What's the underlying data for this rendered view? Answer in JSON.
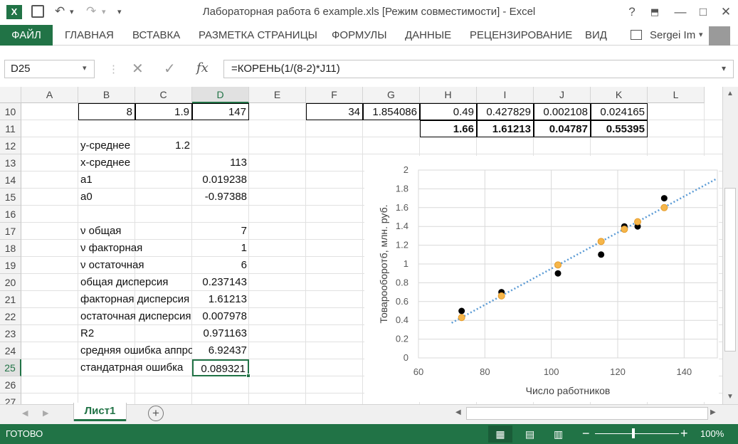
{
  "window": {
    "title": "Лабораторная работа 6 example.xls  [Режим совместимости] - Excel",
    "help": "?",
    "minimize": "—",
    "restore": "□",
    "close": "✕"
  },
  "ribbon": {
    "tabs": [
      "ФАЙЛ",
      "ГЛАВНАЯ",
      "ВСТАВКА",
      "РАЗМЕТКА СТРАНИЦЫ",
      "ФОРМУЛЫ",
      "ДАННЫЕ",
      "РЕЦЕНЗИРОВАНИЕ",
      "ВИД"
    ],
    "user": "Sergei Im"
  },
  "formula_bar": {
    "name_box": "D25",
    "formula": "=КОРЕНЬ(1/(8-2)*J11)",
    "fx": "fx"
  },
  "grid": {
    "columns": [
      "A",
      "B",
      "C",
      "D",
      "E",
      "F",
      "G",
      "H",
      "I",
      "J",
      "K",
      "L"
    ],
    "rows": [
      "10",
      "11",
      "12",
      "13",
      "14",
      "15",
      "16",
      "17",
      "18",
      "19",
      "20",
      "21",
      "22",
      "23",
      "24",
      "25",
      "26",
      "27"
    ],
    "selected_col": "D",
    "selected_row": "25",
    "cells": {
      "B10": "8",
      "C10": "1.9",
      "D10": "147",
      "F10": "34",
      "G10": "1.854086",
      "H10": "0.49",
      "I10": "0.427829",
      "J10": "0.002108",
      "K10": "0.024165",
      "H11": "1.66",
      "I11": "1.61213",
      "J11": "0.04787",
      "K11": "0.55395",
      "B12": "y-среднее",
      "C12": "1.2",
      "B13": "x-среднее",
      "D13": "113",
      "B14": "a1",
      "D14": "0.019238",
      "B15": "a0",
      "D15": "-0.97388",
      "B17": "ν общая",
      "D17": "7",
      "B18": "ν факторная",
      "D18": "1",
      "B19": "ν остаточная",
      "D19": "6",
      "B20": "общая дисперсия",
      "D20": "0.237143",
      "B21": "факторная дисперсия",
      "D21": "1.61213",
      "B22": "остаточная дисперсия",
      "D22": "0.007978",
      "B23": "R2",
      "D23": "0.971163",
      "B24": "средняя ошибка аппроксимации",
      "D24": "6.92437",
      "B25": "стандатрная ошибка",
      "D25": "0.089321"
    }
  },
  "chart_data": {
    "type": "scatter",
    "xlabel": "Число работников",
    "ylabel": "Товарооборотб, млн. руб.",
    "xlim": [
      60,
      150
    ],
    "ylim": [
      0,
      2
    ],
    "xticks": [
      "60",
      "80",
      "100",
      "120",
      "140"
    ],
    "yticks": [
      "0",
      "0.2",
      "0.4",
      "0.6",
      "0.8",
      "1",
      "1.2",
      "1.4",
      "1.6",
      "1.8",
      "2"
    ],
    "series": [
      {
        "color": "#000000",
        "points": [
          [
            73,
            0.5
          ],
          [
            85,
            0.7
          ],
          [
            102,
            0.9
          ],
          [
            115,
            1.1
          ],
          [
            122,
            1.4
          ],
          [
            126,
            1.4
          ],
          [
            134,
            1.7
          ]
        ]
      },
      {
        "color": "#f6b64a",
        "points": [
          [
            73,
            0.43
          ],
          [
            85,
            0.66
          ],
          [
            102,
            0.99
          ],
          [
            115,
            1.24
          ],
          [
            122,
            1.37
          ],
          [
            126,
            1.45
          ],
          [
            134,
            1.6
          ]
        ]
      }
    ],
    "trendline": {
      "slope": 0.019238,
      "intercept": -0.97388,
      "color": "#5b9bd5",
      "style": "dotted"
    }
  },
  "sheets": {
    "active": "Лист1",
    "add": "+"
  },
  "status": {
    "ready": "ГОТОВО",
    "zoom": "100%"
  }
}
